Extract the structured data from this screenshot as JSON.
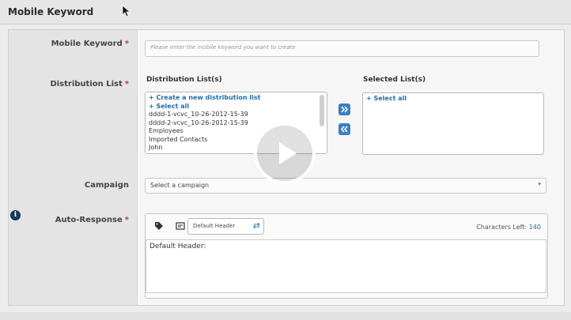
{
  "header": {
    "title": "Mobile Keyword"
  },
  "form": {
    "keyword": {
      "label": "Mobile Keyword",
      "required_mark": "*",
      "placeholder": "Please enter the mobile keyword you want to create"
    },
    "distribution": {
      "label": "Distribution List",
      "required_mark": "*",
      "lists_label": "Distribution List(s)",
      "selected_label": "Selected List(s)",
      "lists": [
        {
          "text": "+ Create a new distribution list",
          "link": true
        },
        {
          "text": "+ Select all",
          "link": true
        },
        {
          "text": "dddd-1-vcvc_10-26-2012-15-39",
          "link": false
        },
        {
          "text": "dddd-2-vcvc_10-26-2012-15-39",
          "link": false
        },
        {
          "text": "Employees",
          "link": false
        },
        {
          "text": "Imported Contacts",
          "link": false
        },
        {
          "text": "John",
          "link": false
        }
      ],
      "selected": [
        {
          "text": "+ Select all",
          "link": true
        }
      ],
      "add_icon": "double-chevron-right-icon",
      "remove_icon": "double-chevron-left-icon"
    },
    "campaign": {
      "label": "Campaign",
      "selected": "Select a campaign"
    },
    "auto_response": {
      "label": "Auto-Response",
      "required_mark": "*",
      "header_select": "Default Header",
      "chars_left_label": "Characters Left:",
      "chars_left_value": "140",
      "text": "Default Header:"
    }
  },
  "overlay": {
    "icon": "play-icon"
  },
  "colors": {
    "accent": "#1f6ea8",
    "required": "#c0392b",
    "info": "#16365c"
  }
}
